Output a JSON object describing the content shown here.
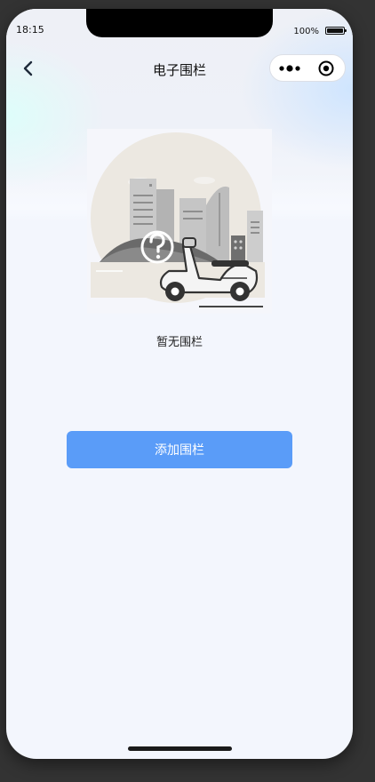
{
  "status_bar": {
    "time": "18:15",
    "battery_percent": "100%"
  },
  "nav": {
    "title": "电子围栏",
    "back_icon": "chevron-left-icon",
    "more_icon": "more-dots-icon",
    "close_icon": "target-circle-icon"
  },
  "empty_state": {
    "illustration": "scooter-city-question-illustration",
    "text": "暂无围栏"
  },
  "actions": {
    "add_label": "添加围栏"
  },
  "colors": {
    "primary_button": "#5a9cf8",
    "page_background": "#f3f6fd"
  }
}
